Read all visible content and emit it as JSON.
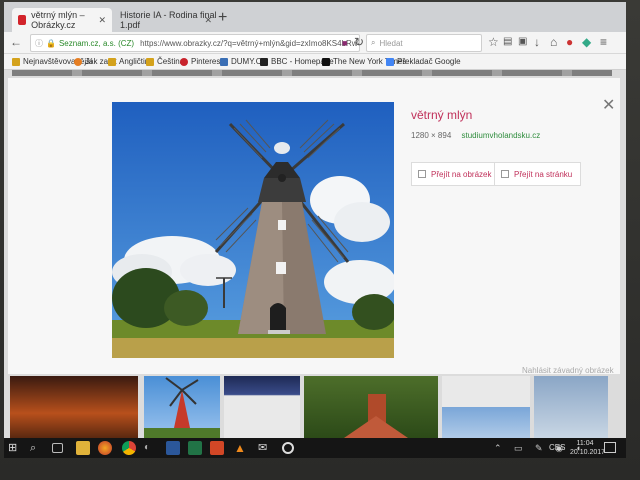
{
  "browser": {
    "tabs": [
      {
        "title": "větrný mlýn – Obrázky.cz",
        "active": true
      },
      {
        "title": "Historie IA - Rodina final 1.pdf",
        "active": false
      }
    ],
    "url_site": "Seznam.cz, a.s. (CZ)",
    "url": "https://www.obrazky.cz/?q=větrný+mlýn&gid=zxImo8KS4bRw4MI3Kz&dim=",
    "search_placeholder": "Hledat",
    "bookmarks": [
      "Nejnavštěvovanější",
      "Jak začít",
      "Angličtina",
      "Čeština",
      "Pinterest",
      "DUMY.CZ",
      "BBC - Homepage",
      "The New York Times",
      "Překladač Google"
    ]
  },
  "detail": {
    "title": "větrný mlýn",
    "dimensions": "1280 × 894",
    "source": "studiumvholandsku.cz",
    "open_image_label": "Přejít na obrázek",
    "open_page_label": "Přejít na stránku",
    "report_label": "Nahlásit závadný obrázek"
  },
  "taskbar": {
    "language": "CES",
    "time": "11:04",
    "date": "20.10.2017"
  },
  "icons": {
    "back": "back-arrow-icon",
    "info": "info-icon",
    "reload": "reload-icon",
    "close": "close-icon"
  },
  "colors": {
    "accent": "#c0305a",
    "source_link": "#2f8d3d"
  }
}
